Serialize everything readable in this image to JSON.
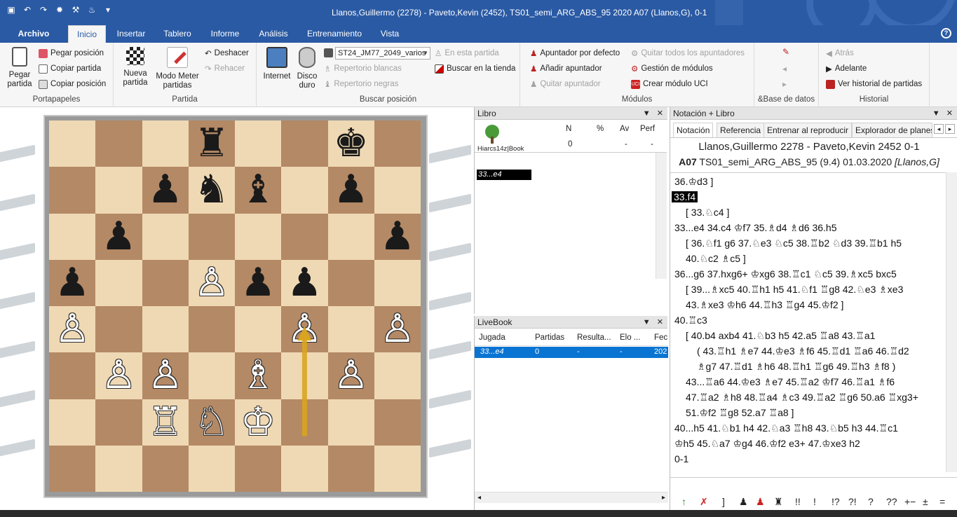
{
  "window": {
    "title": "Llanos,Guillermo (2278) - Paveto,Kevin (2452), TS01_semi_ARG_ABS_95  2020  A07  (Llanos,G), 0-1",
    "qat_icons": [
      "save-icon",
      "undo-icon",
      "redo-icon",
      "engine-icon",
      "tools-icon",
      "bulb-icon",
      "customize-icon"
    ]
  },
  "menu_tabs": [
    {
      "label": "Archivo"
    },
    {
      "label": "Inicio"
    },
    {
      "label": "Insertar"
    },
    {
      "label": "Tablero"
    },
    {
      "label": "Informe"
    },
    {
      "label": "Análisis"
    },
    {
      "label": "Entrenamiento"
    },
    {
      "label": "Vista"
    }
  ],
  "ribbon": {
    "portapapeles": {
      "label": "Portapapeles",
      "pegar": "Pegar partida",
      "pegar_pos": "Pegar posición",
      "copiar_partida": "Copiar partida",
      "copiar_pos": "Copiar posición"
    },
    "partida": {
      "label": "Partida",
      "nueva": "Nueva partida",
      "modo": "Modo Meter partidas",
      "deshacer": "Deshacer",
      "rehacer": "Rehacer"
    },
    "buscar": {
      "label": "Buscar posición",
      "internet": "Internet",
      "disco": "Disco duro",
      "combo": "ST24_JM77_2049_varios",
      "en_esta": "En esta partida",
      "rep_blancas": "Repertorio blancas",
      "rep_negras": "Repertorio negras",
      "tienda": "Buscar en la tienda"
    },
    "modulos": {
      "label": "Módulos",
      "apuntador": "Apuntador por defecto",
      "anadir": "Añadir apuntador",
      "quitar": "Quitar apuntador",
      "quitar_todos": "Quitar todos los apuntadores",
      "gestion": "Gestión de módulos",
      "crear": "Crear módulo UCI"
    },
    "base": {
      "label": "&Base de datos"
    },
    "historial": {
      "label": "Historial",
      "atras": "Atrás",
      "adelante": "Adelante",
      "ver": "Ver historial de partidas"
    }
  },
  "board": {
    "pieces": [
      {
        "sq": "d8",
        "p": "♜",
        "c": "b"
      },
      {
        "sq": "g8",
        "p": "♚",
        "c": "b"
      },
      {
        "sq": "c7",
        "p": "♟",
        "c": "b"
      },
      {
        "sq": "d7",
        "p": "♞",
        "c": "b"
      },
      {
        "sq": "e7",
        "p": "♝",
        "c": "b"
      },
      {
        "sq": "g7",
        "p": "♟",
        "c": "b"
      },
      {
        "sq": "b6",
        "p": "♟",
        "c": "b"
      },
      {
        "sq": "h6",
        "p": "♟",
        "c": "b"
      },
      {
        "sq": "a5",
        "p": "♟",
        "c": "b"
      },
      {
        "sq": "d5",
        "p": "♙",
        "c": "w"
      },
      {
        "sq": "e5",
        "p": "♟",
        "c": "b"
      },
      {
        "sq": "f5",
        "p": "♟",
        "c": "b"
      },
      {
        "sq": "a4",
        "p": "♙",
        "c": "w"
      },
      {
        "sq": "f4",
        "p": "♙",
        "c": "w"
      },
      {
        "sq": "h4",
        "p": "♙",
        "c": "w"
      },
      {
        "sq": "b3",
        "p": "♙",
        "c": "w"
      },
      {
        "sq": "c3",
        "p": "♙",
        "c": "w"
      },
      {
        "sq": "e3",
        "p": "♗",
        "c": "w"
      },
      {
        "sq": "g3",
        "p": "♙",
        "c": "w"
      },
      {
        "sq": "c2",
        "p": "♖",
        "c": "w"
      },
      {
        "sq": "d2",
        "p": "♘",
        "c": "w"
      },
      {
        "sq": "e2",
        "p": "♔",
        "c": "w"
      }
    ],
    "arrow": {
      "from": "f2",
      "to": "f4",
      "color": "#d9a520"
    }
  },
  "libro": {
    "title": "Libro",
    "book_name": "Hiarcs14z|Book",
    "cols": [
      "N",
      "%",
      "Av",
      "Perf"
    ],
    "vals": [
      "0",
      "",
      "-",
      "-"
    ],
    "entry": "33...e4"
  },
  "livebook": {
    "title": "LiveBook",
    "cols": [
      "Jugada",
      "Partidas",
      "Resulta...",
      "Elo ...",
      "Fec"
    ],
    "row": [
      "33...e4",
      "0",
      "-",
      "-",
      "202"
    ]
  },
  "notation": {
    "title": "Notación + Libro",
    "tabs": [
      "Notación",
      "Referencia",
      "Entrenar al reproducir",
      "Explorador de planes"
    ],
    "header1": "Llanos,Guillermo 2278 - Paveto,Kevin 2452  0-1",
    "header2_eco": "A07",
    "header2_rest": " TS01_semi_ARG_ABS_95  (9.4) 01.03.2020 ",
    "header2_annot": "[Llanos,G]",
    "lines": [
      {
        "t": "36.♔d3 ]",
        "x": 6
      },
      {
        "t": "33.f4",
        "x": 2,
        "hl": true
      },
      {
        "t": "[ 33.♘c4 ]",
        "x": 22
      },
      {
        "t": "33...e4  34.c4  ♔f7  35.♗d4  ♗d6  36.h5",
        "x": 6
      },
      {
        "t": "[ 36.♘f1  g6  37.♘e3  ♘c5  38.♖b2  ♘d3  39.♖b1  h5",
        "x": 22
      },
      {
        "t": "40.♘c2  ♗c5 ]",
        "x": 22
      },
      {
        "t": "36...g6  37.hxg6+  ♔xg6  38.♖c1  ♘c5  39.♗xc5  bxc5",
        "x": 6
      },
      {
        "t": "[ 39...♗xc5  40.♖h1  h5  41.♘f1  ♖g8  42.♘e3  ♗xe3",
        "x": 22
      },
      {
        "t": "43.♗xe3  ♔h6  44.♖h3  ♖g4  45.♔f2 ]",
        "x": 22
      },
      {
        "t": "40.♖c3",
        "x": 6
      },
      {
        "t": "[ 40.b4  axb4  41.♘b3  h5  42.a5  ♖a8  43.♖a1",
        "x": 22
      },
      {
        "t": "( 43.♖h1  ♗e7  44.♔e3  ♗f6  45.♖d1  ♖a6  46.♖d2",
        "x": 38
      },
      {
        "t": "♗g7  47.♖d1  ♗h6  48.♖h1  ♖g6  49.♖h3  ♗f8 )",
        "x": 38
      },
      {
        "t": "43...♖a6  44.♔e3  ♗e7  45.♖a2  ♔f7  46.♖a1  ♗f6",
        "x": 22
      },
      {
        "t": "47.♖a2  ♗h8  48.♖a4  ♗c3  49.♖a2  ♖g6  50.a6  ♖xg3+",
        "x": 22
      },
      {
        "t": "51.♔f2  ♖g8  52.a7  ♖a8 ]",
        "x": 22
      },
      {
        "t": "40...h5  41.♘b1  h4  42.♘a3  ♖h8  43.♘b5  h3  44.♖c1",
        "x": 6
      },
      {
        "t": "♔h5  45.♘a7  ♔g4  46.♔f2  e3+  47.♔xe3  h2",
        "x": 6
      },
      {
        "t": "0-1",
        "x": 6
      }
    ],
    "symbols": [
      "!!",
      "!",
      "!?",
      "?!",
      "?",
      "??",
      "+−",
      "±",
      "="
    ]
  },
  "colors": {
    "accent": "#2a5aa4",
    "selection": "#0a74d2",
    "board_light": "#efd9b4",
    "board_dark": "#b48965"
  }
}
